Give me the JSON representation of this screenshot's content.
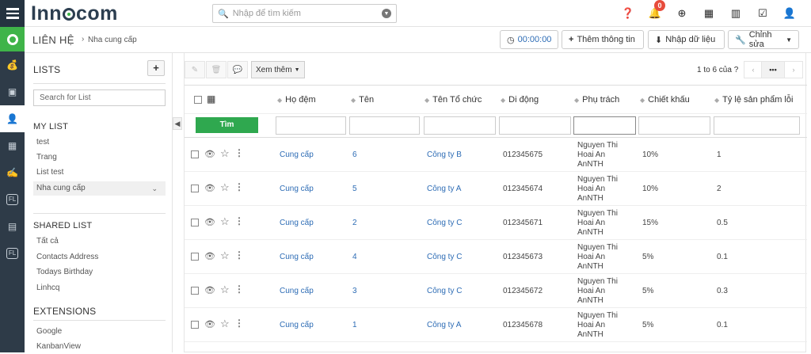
{
  "app": {
    "logo_left": "Inn",
    "logo_right": "com"
  },
  "search": {
    "placeholder": "Nhập để tìm kiếm"
  },
  "notifications": {
    "count": "0"
  },
  "breadcrumb": {
    "section": "LIÊN HỆ",
    "page": "Nha cung cấp"
  },
  "actions": {
    "timer": "00:00:00",
    "add_info": "Thêm thông tin",
    "import_data": "Nhập dữ liệu",
    "edit": "Chỉnh sửa"
  },
  "sidebar": {
    "lists_title": "LISTS",
    "add_label": "+",
    "search_placeholder": "Search for List",
    "my_list_title": "MY LIST",
    "my_list": [
      "test",
      "Trang",
      "List test",
      "Nha cung cấp"
    ],
    "shared_title": "SHARED LIST",
    "shared_list": [
      "Tất cả",
      "Contacts Address",
      "Todays Birthday",
      "Linhcq"
    ],
    "extensions_title": "EXTENSIONS",
    "extensions": [
      "Google",
      "KanbanView"
    ]
  },
  "toolbar": {
    "more_label": "Xem thêm",
    "page_info": "1 to 6 của ?"
  },
  "table": {
    "headers": [
      "Họ đệm",
      "Tên",
      "Tên Tổ chức",
      "Di động",
      "Phụ trách",
      "Chiết khấu",
      "Tỷ lệ sản phẩm lỗi"
    ],
    "search_button": "Tìm",
    "rows": [
      {
        "ho_dem": "Cung cấp",
        "ten": "6",
        "to_chuc": "Công ty B",
        "di_dong": "012345675",
        "phu_trach": [
          "Nguyen Thi",
          "Hoai An",
          "AnNTH"
        ],
        "chiet_khau": "10%",
        "ty_le": "1"
      },
      {
        "ho_dem": "Cung cấp",
        "ten": "5",
        "to_chuc": "Công ty A",
        "di_dong": "012345674",
        "phu_trach": [
          "Nguyen Thi",
          "Hoai An",
          "AnNTH"
        ],
        "chiet_khau": "10%",
        "ty_le": "2"
      },
      {
        "ho_dem": "Cung cấp",
        "ten": "2",
        "to_chuc": "Công ty C",
        "di_dong": "012345671",
        "phu_trach": [
          "Nguyen Thi",
          "Hoai An",
          "AnNTH"
        ],
        "chiet_khau": "15%",
        "ty_le": "0.5"
      },
      {
        "ho_dem": "Cung cấp",
        "ten": "4",
        "to_chuc": "Công ty C",
        "di_dong": "012345673",
        "phu_trach": [
          "Nguyen Thi",
          "Hoai An",
          "AnNTH"
        ],
        "chiet_khau": "5%",
        "ty_le": "0.1"
      },
      {
        "ho_dem": "Cung cấp",
        "ten": "3",
        "to_chuc": "Công ty C",
        "di_dong": "012345672",
        "phu_trach": [
          "Nguyen Thi",
          "Hoai An",
          "AnNTH"
        ],
        "chiet_khau": "5%",
        "ty_le": "0.3"
      },
      {
        "ho_dem": "Cung cấp",
        "ten": "1",
        "to_chuc": "Công ty A",
        "di_dong": "012345678",
        "phu_trach": [
          "Nguyen Thi",
          "Hoai An",
          "AnNTH"
        ],
        "chiet_khau": "5%",
        "ty_le": "0.1"
      }
    ]
  },
  "colors": {
    "accent_green": "#3fb449",
    "link_blue": "#2d6cb5",
    "rail": "#2e3b48",
    "badge_red": "#e74c3c"
  }
}
